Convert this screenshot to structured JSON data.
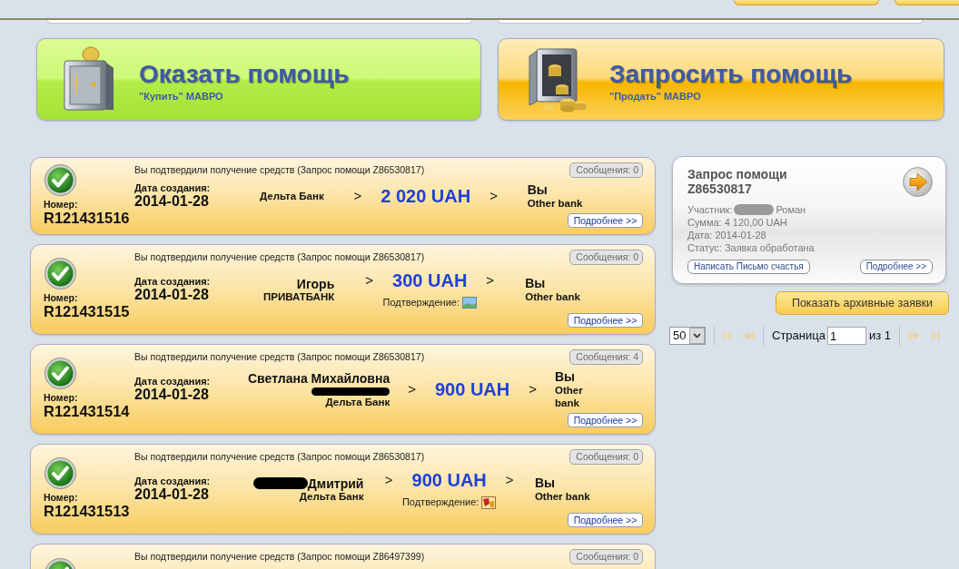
{
  "actions": [
    {
      "kind": "give",
      "title": "Оказать помощь",
      "subtitle": "\"Купить\" МАВРО"
    },
    {
      "kind": "request",
      "title": "Запросить помощь",
      "subtitle": "\"Продать\" МАВРО"
    }
  ],
  "transfers": [
    {
      "status": "Вы подтвердили получение средств (Запрос помощи Z86530817)",
      "messages": "Сообщения: 0",
      "number_label": "Номер:",
      "number": "R121431516",
      "date_label": "Дата создания:",
      "date": "2014-01-28",
      "sender": {
        "bank": "Дельта Банк"
      },
      "arrows": [
        ">",
        ">"
      ],
      "amount": "2 020 UAH",
      "receiver": {
        "name": "Вы",
        "bank": "Other bank"
      },
      "details": "Подробнее >>"
    },
    {
      "status": "Вы подтвердили получение средств (Запрос помощи Z86530817)",
      "messages": "Сообщения: 0",
      "number_label": "Номер:",
      "number": "R121431515",
      "date_label": "Дата создания:",
      "date": "2014-01-28",
      "sender": {
        "name": "Игорь",
        "bank": "ПРИВАТБАНК"
      },
      "arrows": [
        ">",
        ">"
      ],
      "amount": "300 UAH",
      "confirmation": {
        "label": "Подтверждение:",
        "kind": "image"
      },
      "receiver": {
        "name": "Вы",
        "bank": "Other bank"
      },
      "details": "Подробнее >>"
    },
    {
      "status": "Вы подтвердили получение средств (Запрос помощи Z86530817)",
      "messages": "Сообщения: 4",
      "number_label": "Номер:",
      "number": "R121431514",
      "date_label": "Дата создания:",
      "date": "2014-01-28",
      "sender": {
        "name": "Светлана Михайловна",
        "redacted_below_name": true,
        "bank": "Дельта Банк"
      },
      "arrows": [
        ">",
        ">"
      ],
      "amount": "900 UAH",
      "receiver": {
        "name": "Вы",
        "bank": "Other bank"
      },
      "details": "Подробнее >>"
    },
    {
      "status": "Вы подтвердили получение средств (Запрос помощи Z86530817)",
      "messages": "Сообщения: 0",
      "number_label": "Номер:",
      "number": "R121431513",
      "date_label": "Дата создания:",
      "date": "2014-01-28",
      "sender": {
        "name": "Дмитрий",
        "redacted_before_name": true,
        "bank": "Дельта Банк"
      },
      "arrows": [
        ">",
        ">"
      ],
      "amount": "900 UAH",
      "confirmation": {
        "label": "Подтверждение:",
        "kind": "scan"
      },
      "receiver": {
        "name": "Вы",
        "bank": "Other bank"
      },
      "details": "Подробнее >>"
    },
    {
      "status": "Вы подтвердили получение средств (Запрос помощи Z86497399)",
      "messages": "Сообщения: 0"
    }
  ],
  "request_panel": {
    "title": "Запрос помощи Z86530817",
    "participant": {
      "label": "Участник:",
      "redacted_before_name": true,
      "name": "Роман"
    },
    "lines": [
      "Сумма: 4 120,00 UAH",
      "Дата: 2014-01-28",
      "Статус: Заявка обработана"
    ],
    "buttons": [
      "Написать Письмо счастья",
      "Подробнее >>"
    ]
  },
  "archive_button": "Показать архивные заявки",
  "pager": {
    "page_size": "50",
    "page_label": "Страница",
    "page": "1",
    "total": "из 1",
    "nav": [
      {
        "kind": "first",
        "disabled": true
      },
      {
        "kind": "prev",
        "disabled": true
      },
      {
        "kind": "next",
        "disabled": true
      },
      {
        "kind": "last",
        "disabled": true
      }
    ]
  }
}
